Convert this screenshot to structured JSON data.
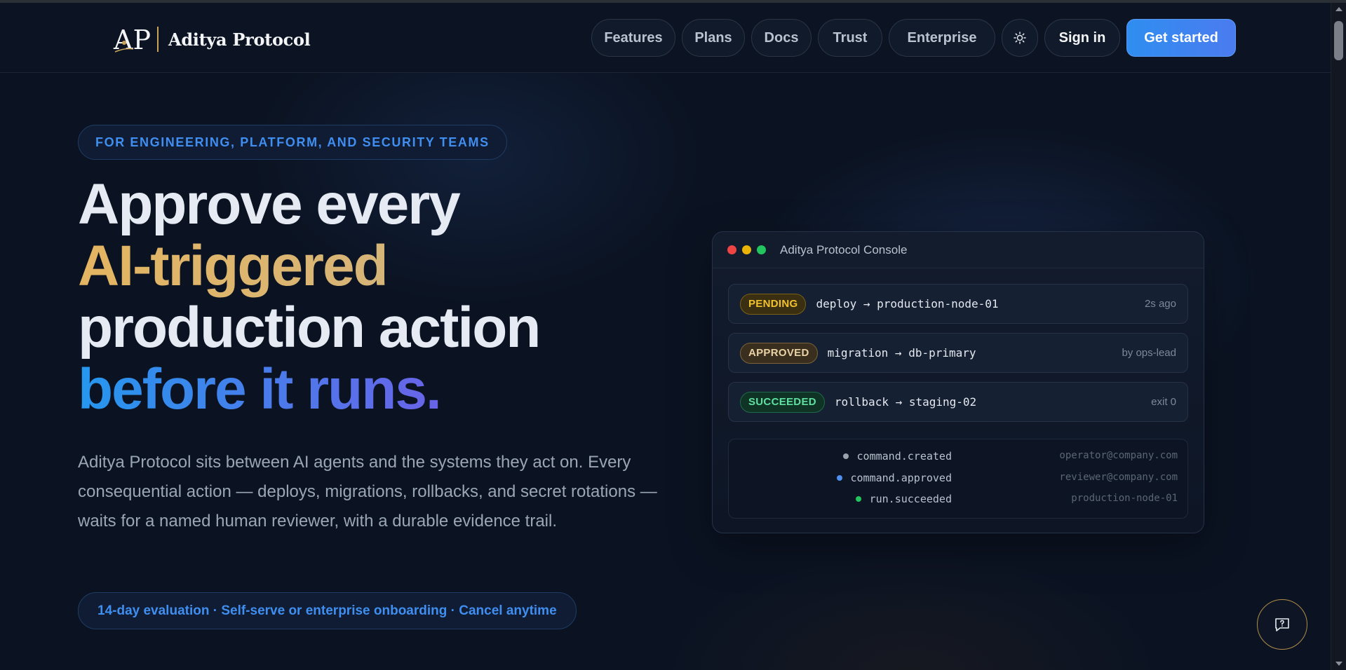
{
  "header": {
    "logo_initials": "AP",
    "brand_name": "Aditya Protocol",
    "nav": [
      {
        "label": "Features"
      },
      {
        "label": "Plans"
      },
      {
        "label": "Docs"
      },
      {
        "label": "Trust"
      },
      {
        "label": "Enterprise"
      }
    ],
    "theme_toggle_icon": "sun-icon",
    "sign_in_label": "Sign in",
    "get_started_label": "Get started"
  },
  "hero": {
    "eyebrow": "FOR ENGINEERING, PLATFORM, AND SECURITY TEAMS",
    "headline_line1": "Approve every",
    "headline_line2": "AI-triggered",
    "headline_line3": "production action",
    "headline_line4": "before it runs.",
    "lead": "Aditya Protocol sits between AI agents and the systems they act on. Every consequential action — deploys, migrations, rollbacks, and secret rotations — waits for a named human reviewer, with a durable evidence trail.",
    "trial_note": "14-day evaluation · Self-serve or enterprise onboarding · Cancel anytime"
  },
  "console": {
    "title": "Aditya Protocol Console",
    "commands": [
      {
        "status": "PENDING",
        "command": "deploy → production-node-01",
        "meta": "2s ago"
      },
      {
        "status": "APPROVED",
        "command": "migration → db-primary",
        "meta": "by ops-lead"
      },
      {
        "status": "SUCCEEDED",
        "command": "rollback → staging-02",
        "meta": "exit 0"
      }
    ],
    "events": [
      {
        "name": "command.created",
        "actor": "operator@company.com",
        "dot_color": "#9aa3ad"
      },
      {
        "name": "command.approved",
        "actor": "reviewer@company.com",
        "dot_color": "#4f8ff0"
      },
      {
        "name": "run.succeeded",
        "actor": "production-node-01",
        "dot_color": "#22c55e"
      }
    ]
  },
  "feedback_icon": "feedback-chat-icon",
  "colors": {
    "background": "#0b1322",
    "accent_blue": "#3f8ef0",
    "accent_gold": "#e4b561",
    "success_green": "#22c55e"
  }
}
